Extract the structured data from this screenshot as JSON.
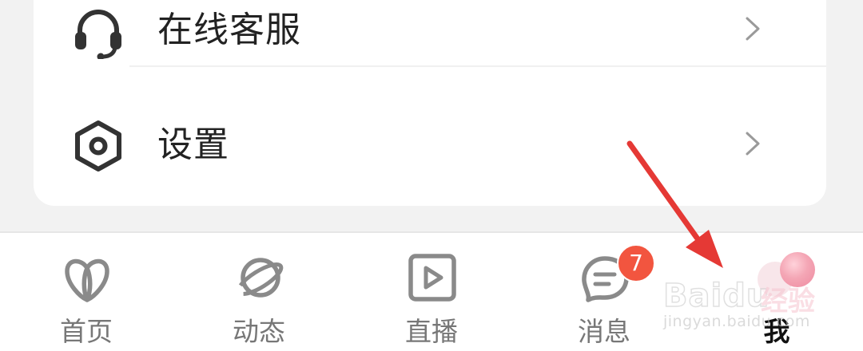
{
  "menu": {
    "items": [
      {
        "label": "在线客服",
        "icon": "headset-icon"
      },
      {
        "label": "设置",
        "icon": "settings-hexagon-icon"
      }
    ]
  },
  "tabbar": {
    "tabs": [
      {
        "label": "首页",
        "icon": "home-logo-icon",
        "active": false
      },
      {
        "label": "动态",
        "icon": "planet-icon",
        "active": false
      },
      {
        "label": "直播",
        "icon": "play-box-icon",
        "active": false
      },
      {
        "label": "消息",
        "icon": "chat-bubble-icon",
        "active": false,
        "badge": "7"
      },
      {
        "label": "我",
        "icon": "me-avatar-icon",
        "active": true
      }
    ]
  },
  "watermark": {
    "brand": "Baidu",
    "product": "经验",
    "url": "jingyan.baidu.com"
  },
  "colors": {
    "badge": "#f2553f",
    "annotation_arrow": "#e53935",
    "icon_gray": "#8a8a8a",
    "active_text": "#111111"
  }
}
